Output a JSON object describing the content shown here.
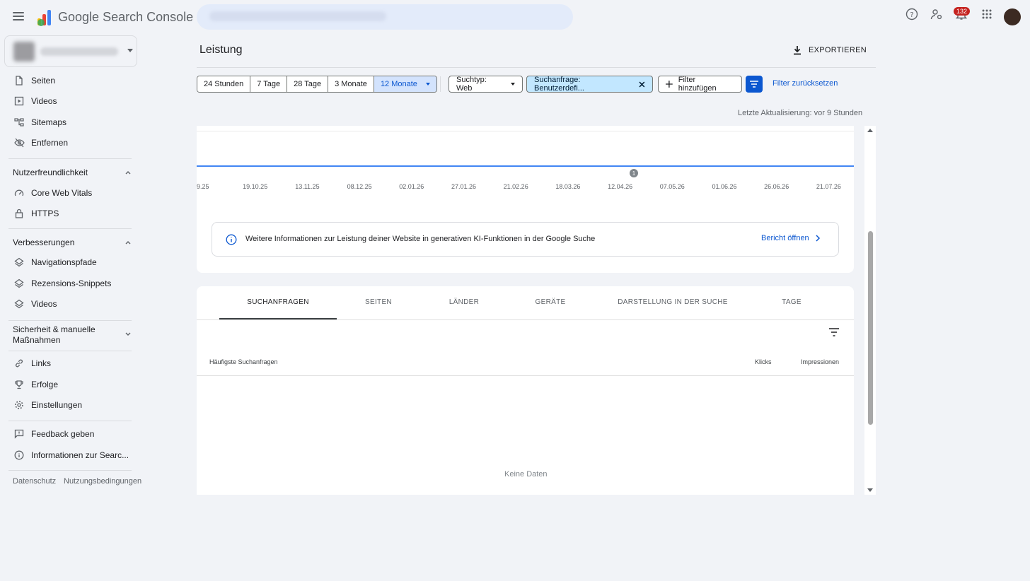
{
  "app": {
    "brand_google": "Google",
    "brand_product": "Search Console"
  },
  "topbar": {
    "notification_count": "132"
  },
  "sidebar": {
    "items_top": [
      {
        "label": "Seiten",
        "icon": "page-icon"
      },
      {
        "label": "Videos",
        "icon": "video-icon"
      },
      {
        "label": "Sitemaps",
        "icon": "sitemap-icon"
      },
      {
        "label": "Entfernen",
        "icon": "eye-off-icon"
      }
    ],
    "section_ux": "Nutzerfreundlichkeit",
    "items_ux": [
      {
        "label": "Core Web Vitals",
        "icon": "speed-icon"
      },
      {
        "label": "HTTPS",
        "icon": "lock-icon"
      }
    ],
    "section_enh": "Verbesserungen",
    "items_enh": [
      {
        "label": "Navigationspfade",
        "icon": "layers-icon"
      },
      {
        "label": "Rezensions-Snippets",
        "icon": "layers-icon"
      },
      {
        "label": "Videos",
        "icon": "layers-icon"
      }
    ],
    "section_sec_line1": "Sicherheit & manuelle",
    "section_sec_line2": "Maßnahmen",
    "items_misc": [
      {
        "label": "Links",
        "icon": "link-icon"
      },
      {
        "label": "Erfolge",
        "icon": "trophy-icon"
      },
      {
        "label": "Einstellungen",
        "icon": "gear-icon"
      }
    ],
    "items_bottom": [
      {
        "label": "Feedback geben",
        "icon": "feedback-icon"
      },
      {
        "label": "Informationen zur Searc...",
        "icon": "info-icon"
      }
    ],
    "footer": {
      "privacy": "Datenschutz",
      "terms": "Nutzungsbedingungen"
    }
  },
  "main": {
    "title": "Leistung",
    "export_label": "EXPORTIEREN",
    "ranges": [
      "24 Stunden",
      "7 Tage",
      "28 Tage",
      "3 Monate",
      "12 Monate"
    ],
    "active_range": "12 Monate",
    "search_type": "Suchtyp: Web",
    "query_filter": "Suchanfrage: Benutzerdefi...",
    "add_filter": "Filter hinzufügen",
    "reset_filter": "Filter zurücksetzen",
    "last_update": "Letzte Aktualisierung: vor 9 Stunden"
  },
  "chart_data": {
    "type": "line",
    "x": [
      "9.25",
      "19.10.25",
      "13.11.25",
      "08.12.25",
      "02.01.26",
      "27.01.26",
      "21.02.26",
      "18.03.26",
      "12.04.26",
      "07.05.26",
      "01.06.26",
      "26.06.26",
      "21.07.26"
    ],
    "annotation_label": "1",
    "series_color": "#4285f4"
  },
  "info_banner": {
    "text": "Weitere Informationen zur Leistung deiner Website in generativen KI-Funktionen in der Google Suche",
    "link": "Bericht öffnen"
  },
  "table": {
    "tabs": [
      "SUCHANFRAGEN",
      "SEITEN",
      "LÄNDER",
      "GERÄTE",
      "DARSTELLUNG IN DER SUCHE",
      "TAGE"
    ],
    "active_tab": "SUCHANFRAGEN",
    "col_query": "Häufigste Suchanfragen",
    "col_clicks": "Klicks",
    "col_impressions": "Impressionen",
    "empty": "Keine Daten"
  }
}
